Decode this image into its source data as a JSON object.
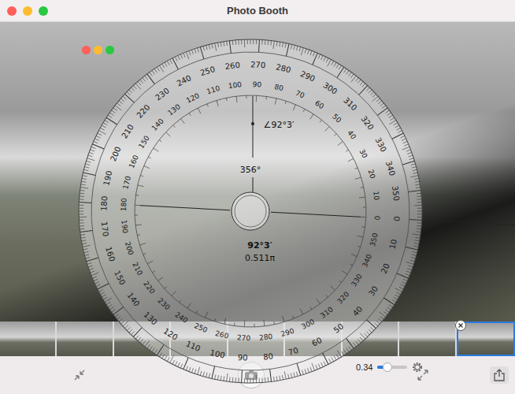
{
  "window": {
    "title": "Photo Booth"
  },
  "protractor": {
    "outer_labels": [
      "0",
      "10",
      "20",
      "30",
      "40",
      "50",
      "60",
      "70",
      "80",
      "90",
      "100",
      "110",
      "120",
      "130",
      "140",
      "150",
      "160",
      "170",
      "180",
      "190",
      "200",
      "210",
      "220",
      "230",
      "240",
      "250",
      "260",
      "270",
      "280",
      "290",
      "300",
      "310",
      "320",
      "330",
      "340",
      "350"
    ],
    "inner_labels": [
      "0",
      "10",
      "20",
      "30",
      "40",
      "50",
      "60",
      "70",
      "80",
      "90",
      "100",
      "110",
      "120",
      "130",
      "140",
      "150",
      "160",
      "170",
      "180",
      "190",
      "200",
      "210",
      "220",
      "230",
      "240",
      "250",
      "260",
      "270",
      "280",
      "290",
      "300",
      "310",
      "320",
      "330",
      "340",
      "350"
    ],
    "angle_readout": "∠92°3′",
    "bearing": "356°",
    "angle": "92°3′",
    "radians": "0.511π",
    "opacity": {
      "reading": "0.34",
      "level": 0.34
    }
  },
  "thumbnails": [
    {
      "selected": false
    },
    {
      "selected": false
    },
    {
      "selected": false
    },
    {
      "selected": false
    },
    {
      "selected": false
    },
    {
      "selected": false
    },
    {
      "selected": false
    },
    {
      "selected": false
    },
    {
      "selected": true
    }
  ]
}
